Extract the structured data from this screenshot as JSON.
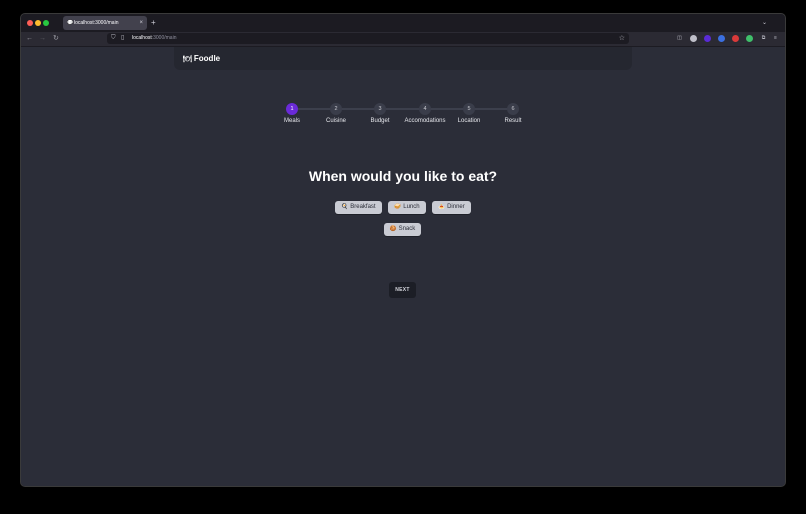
{
  "browser": {
    "tab": {
      "title": "localhost:3000/main",
      "icon": "chat-bubble-icon"
    },
    "url": {
      "host": "localhost",
      "path": ":3000/main"
    }
  },
  "app": {
    "brand": {
      "icon": "plate-cutlery-icon",
      "emoji": "🍽",
      "name": "Foodle"
    }
  },
  "stepper": {
    "steps": [
      {
        "number": "1",
        "label": "Meals",
        "active": true
      },
      {
        "number": "2",
        "label": "Cuisine",
        "active": false
      },
      {
        "number": "3",
        "label": "Budget",
        "active": false
      },
      {
        "number": "4",
        "label": "Accomodations",
        "active": false
      },
      {
        "number": "5",
        "label": "Location",
        "active": false
      },
      {
        "number": "6",
        "label": "Result",
        "active": false
      }
    ],
    "colors": {
      "active": "#6a2ad8",
      "inactive": "#3a3d4a"
    }
  },
  "question": {
    "title": "When would you like to eat?"
  },
  "meals": {
    "options": [
      {
        "emoji": "🍳",
        "label": "Breakfast",
        "icon": "frying-pan-icon"
      },
      {
        "emoji": "🥪",
        "label": "Lunch",
        "icon": "sandwich-icon"
      },
      {
        "emoji": "🍝",
        "label": "Dinner",
        "icon": "spaghetti-icon"
      },
      {
        "emoji": "🍪",
        "label": "Snack",
        "icon": "cookie-icon"
      }
    ]
  },
  "actions": {
    "next_label": "NEXT"
  }
}
